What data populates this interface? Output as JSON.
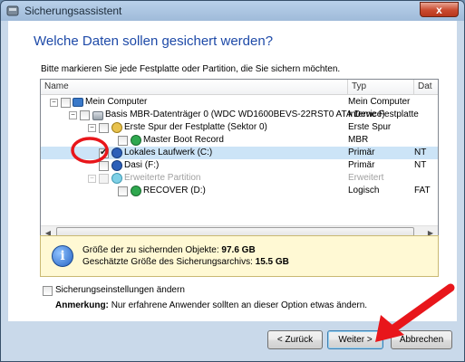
{
  "window": {
    "title": "Sicherungsassistent",
    "close_glyph": "x"
  },
  "page": {
    "heading": "Welche Daten sollen gesichert werden?",
    "instruction": "Bitte markieren Sie jede Festplatte oder Partition, die Sie sichern möchten."
  },
  "tree": {
    "columns": [
      "Name",
      "Typ",
      "Dat"
    ],
    "rows": [
      {
        "name": "Mein Computer",
        "typ": "Mein Computer",
        "dat": ""
      },
      {
        "name": "Basis MBR-Datenträger 0 (WDC WD1600BEVS-22RST0 ATA Device)",
        "typ": "Interne Festplatte",
        "dat": ""
      },
      {
        "name": "Erste Spur der Festplatte (Sektor 0)",
        "typ": "Erste Spur",
        "dat": ""
      },
      {
        "name": "Master Boot Record",
        "typ": "MBR",
        "dat": ""
      },
      {
        "name": "Lokales Laufwerk (C:)",
        "typ": "Primär",
        "dat": "NT"
      },
      {
        "name": "Dasi (F:)",
        "typ": "Primär",
        "dat": "NT"
      },
      {
        "name": "Erweiterte Partition",
        "typ": "Erweitert",
        "dat": ""
      },
      {
        "name": "RECOVER (D:)",
        "typ": "Logisch",
        "dat": "FAT"
      }
    ],
    "selected_row": "Lokales Laufwerk (C:)"
  },
  "info": {
    "line1_label": "Größe der zu sichernden Objekte:",
    "line1_value": "97.6 GB",
    "line2_label": "Geschätzte Größe des Sicherungsarchivs:",
    "line2_value": "15.5 GB"
  },
  "options": {
    "settings_label": "Sicherungseinstellungen ändern",
    "note_bold": "Anmerkung:",
    "note_text": "Nur erfahrene Anwender sollten an dieser Option etwas ändern."
  },
  "buttons": {
    "back": "< Zurück",
    "next": "Weiter >",
    "cancel": "Abbrechen"
  },
  "colors": {
    "heading": "#1e4aa8",
    "annotation_red": "#e8161b",
    "info_bg": "#fff9d4"
  }
}
